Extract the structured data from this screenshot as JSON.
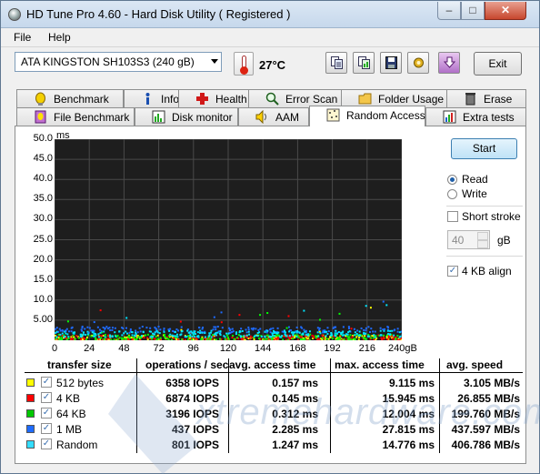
{
  "window": {
    "title": "HD Tune Pro 4.60 - Hard Disk Utility (  Registered )",
    "min": "–",
    "max": "□",
    "close": "✕"
  },
  "menu": {
    "file": "File",
    "help": "Help"
  },
  "toolbar": {
    "drive": "ATA     KINGSTON SH103S3 (240 gB)",
    "temperature": "27°C",
    "exit": "Exit",
    "icons": [
      "copy-text-icon",
      "copy-screenshot-icon",
      "save-icon",
      "options-icon",
      "download-icon"
    ]
  },
  "tabs_row1": [
    {
      "label": "Benchmark",
      "icon": "benchmark-icon",
      "active": false
    },
    {
      "label": "Info",
      "icon": "info-icon",
      "active": false
    },
    {
      "label": "Health",
      "icon": "health-icon",
      "active": false
    },
    {
      "label": "Error Scan",
      "icon": "error-scan-icon",
      "active": false
    },
    {
      "label": "Folder Usage",
      "icon": "folder-icon",
      "active": false
    },
    {
      "label": "Erase",
      "icon": "erase-icon",
      "active": false
    }
  ],
  "tabs_row2": [
    {
      "label": "File Benchmark",
      "icon": "file-benchmark-icon",
      "active": false
    },
    {
      "label": "Disk monitor",
      "icon": "disk-monitor-icon",
      "active": false
    },
    {
      "label": "AAM",
      "icon": "aam-icon",
      "active": false
    },
    {
      "label": "Random Access",
      "icon": "random-access-icon",
      "active": true
    },
    {
      "label": "Extra tests",
      "icon": "extra-tests-icon",
      "active": false
    }
  ],
  "controls": {
    "start": "Start",
    "read": "Read",
    "write": "Write",
    "short_stroke": "Short stroke",
    "stroke_value": "40",
    "stroke_unit": "gB",
    "align": "4 KB align",
    "mode": "read",
    "align_checked": true,
    "short_stroke_checked": false
  },
  "chart_data": {
    "type": "scatter",
    "ylabel": "ms",
    "y_ticks": [
      "50.0",
      "45.0",
      "40.0",
      "35.0",
      "30.0",
      "25.0",
      "20.0",
      "15.0",
      "10.0",
      "5.00"
    ],
    "x_ticks": [
      "0",
      "24",
      "48",
      "72",
      "96",
      "120",
      "144",
      "168",
      "192",
      "216",
      "240gB"
    ],
    "ylim": [
      0,
      50
    ],
    "xlim": [
      0,
      240
    ],
    "grid": true,
    "series": [
      {
        "name": "512 bytes",
        "color": "#ffff00",
        "values": [
          0.157
        ]
      },
      {
        "name": "4 KB",
        "color": "#ff0000",
        "values": [
          0.145
        ]
      },
      {
        "name": "64 KB",
        "color": "#00ff00",
        "values": [
          0.312
        ]
      },
      {
        "name": "1 MB",
        "color": "#1e6bff",
        "values": [
          2.285
        ]
      },
      {
        "name": "Random",
        "color": "#00e5ff",
        "values": [
          1.247
        ]
      }
    ]
  },
  "table": {
    "headers": [
      "transfer size",
      "operations / sec",
      "avg. access time",
      "max. access time",
      "avg. speed"
    ],
    "rows": [
      {
        "label": "512 bytes",
        "color": "#ffff00",
        "ops": "6358 IOPS",
        "avg": "0.157 ms",
        "max": "9.115 ms",
        "speed": "3.105 MB/s"
      },
      {
        "label": "4 KB",
        "color": "#ff0000",
        "ops": "6874 IOPS",
        "avg": "0.145 ms",
        "max": "15.945 ms",
        "speed": "26.855 MB/s"
      },
      {
        "label": "64 KB",
        "color": "#00c800",
        "ops": "3196 IOPS",
        "avg": "0.312 ms",
        "max": "12.004 ms",
        "speed": "199.760 MB/s"
      },
      {
        "label": "1 MB",
        "color": "#1e6bff",
        "ops": "437 IOPS",
        "avg": "2.285 ms",
        "max": "27.815 ms",
        "speed": "437.597 MB/s"
      },
      {
        "label": "Random",
        "color": "#33ddff",
        "ops": "801 IOPS",
        "avg": "1.247 ms",
        "max": "14.776 ms",
        "speed": "406.786 MB/s"
      }
    ],
    "check_mark": "✓"
  },
  "watermark": "xtremehardware.com"
}
